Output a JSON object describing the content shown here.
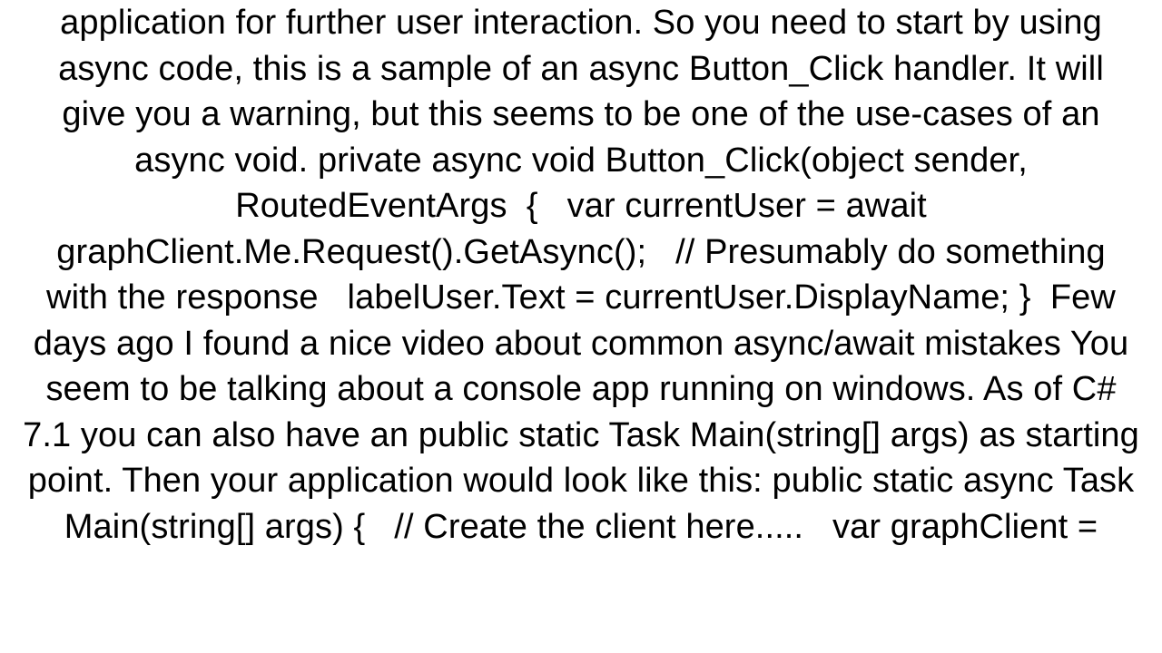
{
  "body": {
    "text": "application for further user interaction. So you need to start by using async code, this is a sample of an async Button_Click handler. It will give you a warning, but this seems to be one of the use-cases of an async void. private async void Button_Click(object sender, RoutedEventArgs  {   var currentUser = await graphClient.Me.Request().GetAsync();   // Presumably do something with the response   labelUser.Text = currentUser.DisplayName; }  Few days ago I found a nice video about common async/await mistakes You seem to be talking about a console app running on windows. As of C# 7.1 you can also have an public static Task Main(string[] args) as starting point. Then your application would look like this: public static async Task Main(string[] args) {   // Create the client here.....   var graphClient ="
  }
}
